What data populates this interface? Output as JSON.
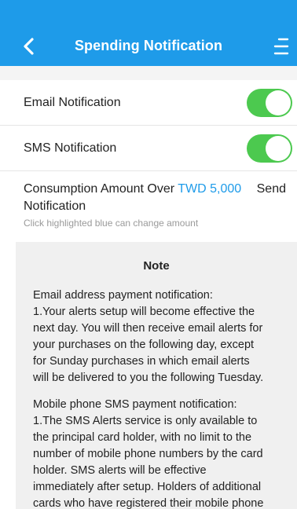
{
  "header": {
    "title": "Spending Notification",
    "back_icon": "chevron-left-icon",
    "menu_icon": "menu-icon",
    "background": "#1e9be9"
  },
  "settings": {
    "email": {
      "label": "Email Notification",
      "enabled": true
    },
    "sms": {
      "label": "SMS Notification",
      "enabled": true
    },
    "toggle_color": "#4cc94f"
  },
  "amount": {
    "prefix": "Consumption Amount Over",
    "value": "TWD 5,000",
    "suffix": "Send",
    "line2": "Notification",
    "hint": "Click highlighted blue can change amount",
    "accent": "#1e9be9"
  },
  "note": {
    "title": "Note",
    "email_lines": [
      "Email address payment notification:",
      "1.Your alerts setup will become effective the",
      "next day. You will then receive email alerts for",
      "your purchases on the following day, except",
      "for Sunday purchases in which email alerts",
      "will be delivered to you the following Tuesday."
    ],
    "sms_lines": [
      "Mobile phone SMS payment notification:",
      "1.The SMS Alerts service is only available to",
      "the principal card holder, with no limit to the",
      "number of mobile phone numbers by the card",
      "holder. SMS alerts will be effective",
      "immediately after setup. Holders of additional",
      "cards who have registered their mobile phone"
    ]
  }
}
